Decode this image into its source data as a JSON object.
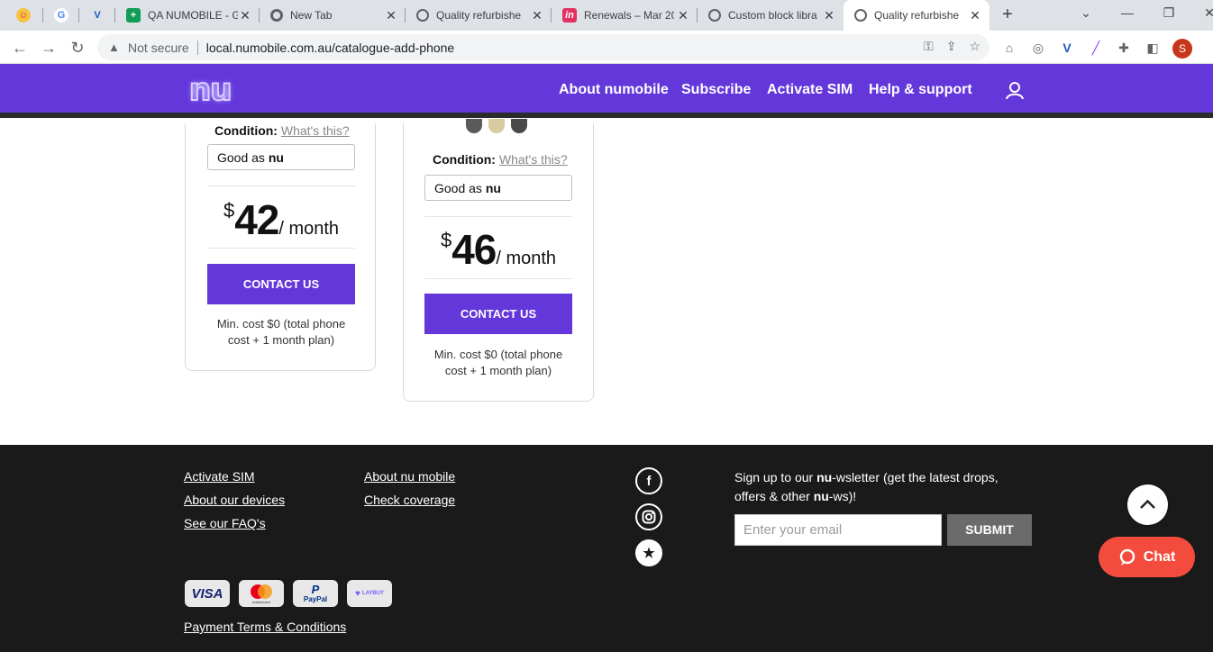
{
  "browser": {
    "tabs": [
      {
        "title": "",
        "favicon": "smiley-icon"
      },
      {
        "title": "",
        "favicon": "google-icon"
      },
      {
        "title": "",
        "favicon": "v-logo-icon"
      },
      {
        "title": "QA NUMOBILE - G",
        "favicon": "sheets-icon"
      },
      {
        "title": "New Tab",
        "favicon": "chrome-icon"
      },
      {
        "title": "Quality refurbishe",
        "favicon": "globe-icon"
      },
      {
        "title": "Renewals – Mar 20",
        "favicon": "invision-icon"
      },
      {
        "title": "Custom block libra",
        "favicon": "globe-icon"
      },
      {
        "title": "Quality refurbishe",
        "favicon": "globe-icon",
        "active": true
      }
    ],
    "security_label": "Not secure",
    "url": "local.numobile.com.au/catalogue-add-phone",
    "profile_initial": "S"
  },
  "header": {
    "logo": "nu",
    "nav": [
      "About numobile",
      "Subscribe",
      "Activate SIM",
      "Help & support"
    ]
  },
  "cards": [
    {
      "condition_label": "Condition:",
      "condition_help": "What's this?",
      "condition_value_prefix": "Good as ",
      "condition_value_bold": "nu",
      "currency": "$",
      "price": "42",
      "period": "/ month",
      "cta": "CONTACT US",
      "min_cost": "Min. cost $0 (total phone cost + 1 month plan)"
    },
    {
      "condition_label": "Condition:",
      "condition_help": "What's this?",
      "condition_value_prefix": "Good as ",
      "condition_value_bold": "nu",
      "currency": "$",
      "price": "46",
      "period": "/ month",
      "cta": "CONTACT US",
      "min_cost": "Min. cost $0 (total phone cost + 1 month plan)",
      "swatches": [
        "#5a5a5a",
        "#d9cba0",
        "#4a4a4a"
      ]
    }
  ],
  "footer": {
    "links_col1": [
      "Activate SIM",
      "About our devices",
      "See our FAQ's"
    ],
    "links_col2": [
      "About nu mobile",
      "Check coverage"
    ],
    "social": [
      "facebook-icon",
      "instagram-icon",
      "star-icon"
    ],
    "newsletter_pre": "Sign up to our ",
    "newsletter_bold1": "nu",
    "newsletter_mid": "-wsletter (get the latest drops, offers & other ",
    "newsletter_bold2": "nu",
    "newsletter_post": "-ws)!",
    "email_placeholder": "Enter your email",
    "submit": "SUBMIT",
    "payments": [
      "VISA",
      "mastercard",
      "PayPal",
      "LAYBUY"
    ],
    "terms": "Payment Terms & Conditions"
  },
  "chat_label": "Chat",
  "colors": {
    "brand": "#6437db",
    "chat": "#f34c3e",
    "footer": "#1a1a1a"
  }
}
